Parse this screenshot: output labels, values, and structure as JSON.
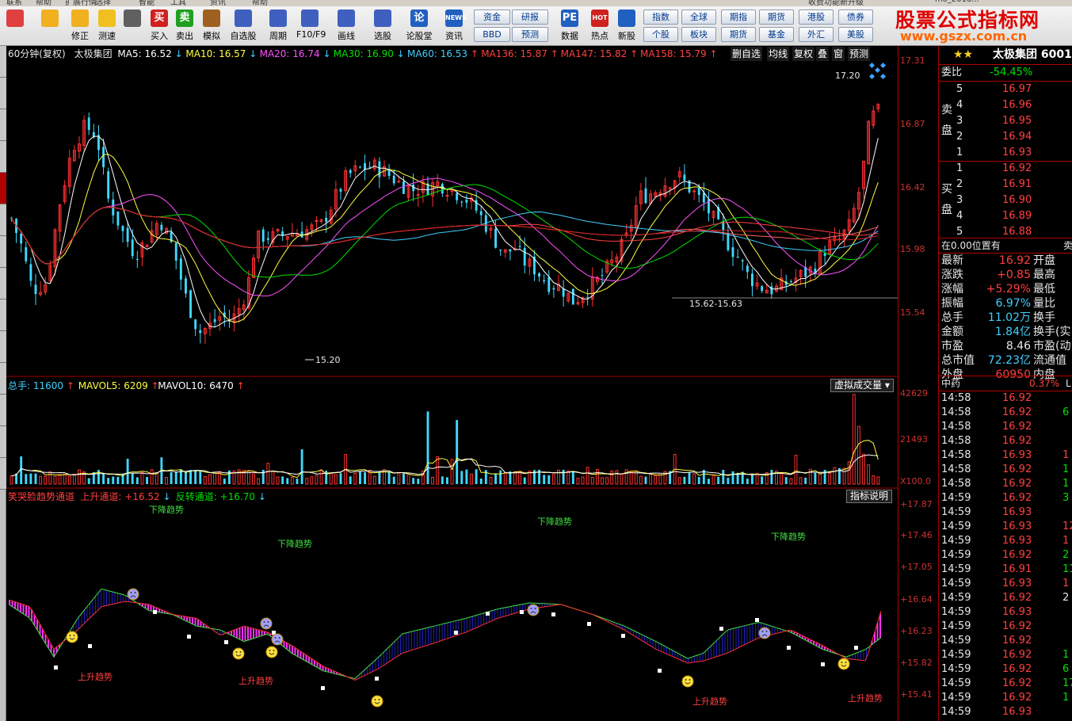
{
  "menubar": {
    "items": [
      "联系",
      "帮助",
      "扩展行情",
      "选择",
      "智能",
      "工具",
      "资讯",
      "帮助"
    ],
    "right": "收费功能新升级",
    "date": "mo_2018..."
  },
  "toolbar": {
    "buttons": [
      {
        "label": "",
        "icon": "grid-icon",
        "color": "#e04040"
      },
      {
        "label": "",
        "icon": "back-arrow-icon",
        "color": "#f0b020"
      },
      {
        "label": "修正",
        "icon": "updown-arrows-icon",
        "color": "#f0b020"
      },
      {
        "label": "测速",
        "icon": "smiley-icon",
        "color": "#f0c020"
      },
      {
        "label": "",
        "icon": "clock-icon",
        "color": "#606060"
      },
      {
        "label": "买入",
        "icon": "buy-icon",
        "color": "#d02020",
        "glyph": "买"
      },
      {
        "label": "卖出",
        "icon": "sell-icon",
        "color": "#20a020",
        "glyph": "卖"
      },
      {
        "label": "模拟",
        "icon": "hammer-icon",
        "color": "#a06020"
      },
      {
        "label": "自选股",
        "icon": "star-icon",
        "color": "#4060c0"
      },
      {
        "label": "周期",
        "icon": "period-icon",
        "color": "#4060c0"
      },
      {
        "label": "F10/F9",
        "icon": "f10-icon",
        "color": "#4060c0"
      },
      {
        "label": "画线",
        "icon": "pencil-icon",
        "color": "#4060c0"
      },
      {
        "label": "选股",
        "icon": "screen-icon",
        "color": "#4060c0"
      },
      {
        "label": "论股堂",
        "icon": "forum-icon",
        "color": "#2060c0",
        "glyph": "论"
      },
      {
        "label": "资讯",
        "icon": "news-icon",
        "color": "#2060c0",
        "glyph": "NEWS"
      },
      {
        "label": "数据",
        "icon": "pe-icon",
        "color": "#2060c0",
        "glyph": "PE"
      },
      {
        "label": "热点",
        "icon": "hot-icon",
        "color": "#d02020",
        "glyph": "HOT"
      },
      {
        "label": "新股",
        "icon": "new-stock-icon",
        "color": "#2060c0"
      }
    ],
    "square_buttons": [
      "资金",
      "研报",
      "BBD",
      "预测",
      "指数",
      "全球",
      "期指",
      "期货",
      "港股",
      "债券",
      "个股",
      "板块",
      "期货",
      "基金",
      "外汇",
      "美股"
    ]
  },
  "brand": {
    "line1": "股票公式指标网",
    "line2": "www.gszx.com.cn"
  },
  "kline": {
    "header": [
      {
        "text": "60分钟(复权)",
        "color": "#e8e8e8"
      },
      {
        "text": "太极集团",
        "color": "#e8e8e8"
      },
      {
        "text": "MA5: 16.52",
        "arrow": "↓",
        "color": "#ffffff",
        "acolor": "#40d0ff"
      },
      {
        "text": "MA10: 16.57",
        "arrow": "↓",
        "color": "#ffff40",
        "acolor": "#40d0ff"
      },
      {
        "text": "MA20: 16.74",
        "arrow": "↓",
        "color": "#ff50ff",
        "acolor": "#40d0ff"
      },
      {
        "text": "MA30: 16.90",
        "arrow": "↓",
        "color": "#00e000",
        "acolor": "#40d0ff"
      },
      {
        "text": "MA60: 16.53",
        "arrow": "↑",
        "color": "#40d0ff",
        "acolor": "#ff4040"
      },
      {
        "text": "MA136: 15.87",
        "arrow": "↑",
        "color": "#ff4040",
        "acolor": "#ff4040"
      },
      {
        "text": "MA147: 15.82",
        "arrow": "↑",
        "color": "#ff4040",
        "acolor": "#ff4040"
      },
      {
        "text": "MA158: 15.79",
        "arrow": "↑",
        "color": "#ff4040",
        "acolor": "#ff4040"
      }
    ],
    "buttons": [
      "删自选",
      "均线",
      "复权",
      "叠",
      "窗",
      "预测"
    ],
    "annotations": {
      "high": "17.20",
      "low": "15.20",
      "range": "15.62-15.63"
    },
    "yaxis": [
      "17.31",
      "16.87",
      "16.42",
      "15.98",
      "15.54"
    ]
  },
  "volume": {
    "header": [
      {
        "text": "总手: 11600",
        "arrow": "↑",
        "color": "#40d0ff",
        "acolor": "#ff4040"
      },
      {
        "text": "MAVOL5: 6209",
        "arrow": "↑",
        "color": "#ffff40",
        "acolor": "#ff4040"
      },
      {
        "text": "MAVOL10: 6470",
        "arrow": "↑",
        "color": "#ffffff",
        "acolor": "#ff4040"
      }
    ],
    "button": "虚拟成交量",
    "yaxis": [
      "42629",
      "21493",
      "X100.0"
    ]
  },
  "indicator": {
    "header": [
      {
        "text": "笑哭脸趋势通道",
        "color": "#ff4040"
      },
      {
        "text": "上升通道: +16.52",
        "arrow": "↓",
        "color": "#ff4040",
        "acolor": "#40d0ff"
      },
      {
        "text": "反转通道: +16.70",
        "arrow": "↓",
        "color": "#00e000",
        "acolor": "#40d0ff"
      }
    ],
    "button": "指标说明",
    "down_label": "下降趋势",
    "up_label": "上升趋势",
    "yaxis": [
      "+17.87",
      "+17.46",
      "+17.05",
      "+16.64",
      "+16.23",
      "+15.82",
      "+15.41"
    ]
  },
  "quote": {
    "stars": "★★",
    "name": "太极集团 6001",
    "webi_label": "委比",
    "webi_value": "-54.45%",
    "sell_label": "卖盘",
    "buy_label": "买盘",
    "sell": [
      {
        "n": "5",
        "p": "16.97"
      },
      {
        "n": "4",
        "p": "16.96"
      },
      {
        "n": "3",
        "p": "16.95"
      },
      {
        "n": "2",
        "p": "16.94"
      },
      {
        "n": "1",
        "p": "16.93"
      }
    ],
    "buy": [
      {
        "n": "1",
        "p": "16.92"
      },
      {
        "n": "2",
        "p": "16.91"
      },
      {
        "n": "3",
        "p": "16.90"
      },
      {
        "n": "4",
        "p": "16.89"
      },
      {
        "n": "5",
        "p": "16.88"
      }
    ],
    "position": "在0.00位置有",
    "position_right": "卖",
    "stats": [
      {
        "k": "最新",
        "v": "16.92",
        "vc": "#ff4040",
        "k2": "开盘"
      },
      {
        "k": "涨跌",
        "v": "+0.85",
        "vc": "#ff4040",
        "k2": "最高"
      },
      {
        "k": "涨幅",
        "v": "+5.29%",
        "vc": "#ff4040",
        "k2": "最低"
      },
      {
        "k": "振幅",
        "v": "6.97%",
        "vc": "#40d0ff",
        "k2": "量比"
      },
      {
        "k": "总手",
        "v": "11.02万",
        "vc": "#40d0ff",
        "k2": "换手"
      },
      {
        "k": "金额",
        "v": "1.84亿",
        "vc": "#40d0ff",
        "k2": "换手(实"
      },
      {
        "k": "市盈",
        "v": "8.46",
        "vc": "#e8e8e8",
        "k2": "市盈(动"
      },
      {
        "k": "总市值",
        "v": "72.23亿",
        "vc": "#40d0ff",
        "k2": "流通值"
      },
      {
        "k": "外盘",
        "v": "60950",
        "vc": "#ff4040",
        "k2": "内盘"
      }
    ],
    "sector": "中药",
    "sector_pct": "0.37%",
    "sector_right": "L",
    "ticks": [
      {
        "t": "14:58",
        "p": "16.92",
        "v": "",
        "vc": "#ff4040"
      },
      {
        "t": "14:58",
        "p": "16.92",
        "v": "6",
        "vc": "#00e000"
      },
      {
        "t": "14:58",
        "p": "16.92",
        "v": "",
        "vc": "#ff4040"
      },
      {
        "t": "14:58",
        "p": "16.92",
        "v": "",
        "vc": "#ff4040"
      },
      {
        "t": "14:58",
        "p": "16.93",
        "v": "1",
        "vc": "#ff4040"
      },
      {
        "t": "14:58",
        "p": "16.92",
        "v": "1",
        "vc": "#00e000"
      },
      {
        "t": "14:58",
        "p": "16.92",
        "v": "1",
        "vc": "#00e000"
      },
      {
        "t": "14:59",
        "p": "16.92",
        "v": "3",
        "vc": "#00e000"
      },
      {
        "t": "14:59",
        "p": "16.93",
        "v": "",
        "vc": "#ff4040"
      },
      {
        "t": "14:59",
        "p": "16.93",
        "v": "12",
        "vc": "#ff4040"
      },
      {
        "t": "14:59",
        "p": "16.93",
        "v": "1",
        "vc": "#ff4040"
      },
      {
        "t": "14:59",
        "p": "16.92",
        "v": "2",
        "vc": "#00e000"
      },
      {
        "t": "14:59",
        "p": "16.91",
        "v": "11",
        "vc": "#00e000"
      },
      {
        "t": "14:59",
        "p": "16.93",
        "v": "1",
        "vc": "#ff4040"
      },
      {
        "t": "14:59",
        "p": "16.92",
        "v": "2",
        "vc": "#e8e8e8"
      },
      {
        "t": "14:59",
        "p": "16.93",
        "v": "",
        "vc": "#ff4040"
      },
      {
        "t": "14:59",
        "p": "16.92",
        "v": "",
        "vc": "#ff4040"
      },
      {
        "t": "14:59",
        "p": "16.92",
        "v": "",
        "vc": "#ff4040"
      },
      {
        "t": "14:59",
        "p": "16.92",
        "v": "1",
        "vc": "#00e000"
      },
      {
        "t": "14:59",
        "p": "16.92",
        "v": "6",
        "vc": "#00e000"
      },
      {
        "t": "14:59",
        "p": "16.92",
        "v": "17",
        "vc": "#00e000"
      },
      {
        "t": "14:59",
        "p": "16.92",
        "v": "1",
        "vc": "#00e000"
      },
      {
        "t": "14:59",
        "p": "16.93",
        "v": "",
        "vc": "#ff4040"
      }
    ]
  }
}
